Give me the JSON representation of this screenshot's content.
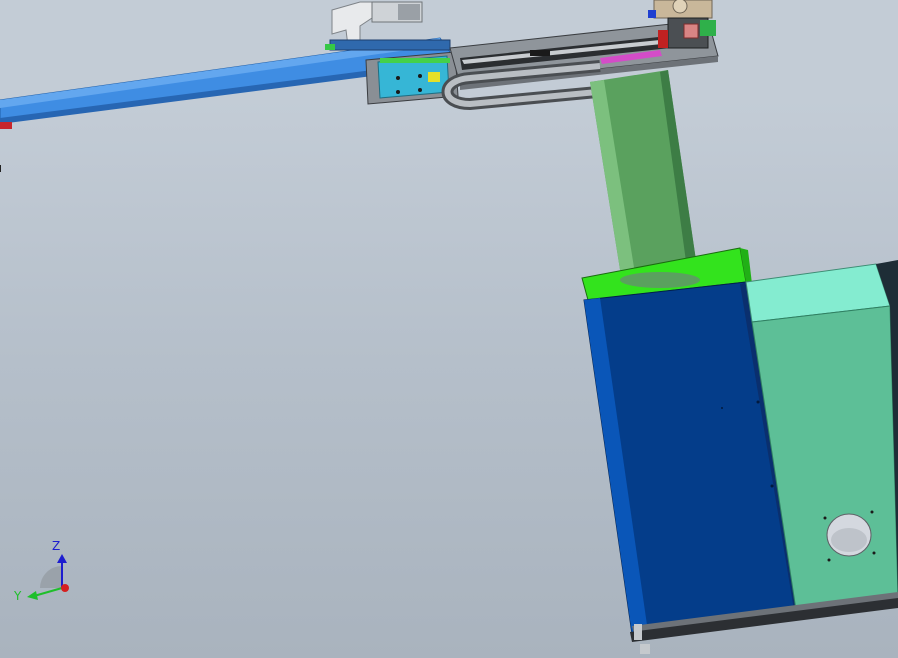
{
  "viewport": {
    "background_top": "#c3ccd6",
    "background_bottom": "#a9b3be"
  },
  "model": {
    "parts": [
      "horizontal-arm",
      "gripper",
      "linear-slide",
      "cable-chain",
      "vertical-column",
      "base-cabinet",
      "side-panel",
      "round-port"
    ],
    "colors": {
      "arm": "#3f8de3",
      "arm_dark": "#2766b3",
      "slide_body": "#8f959b",
      "slide_dark": "#3a3d41",
      "carriage": "#36b6d6",
      "column": "#5aa15e",
      "column_dark": "#3d7d45",
      "column_collar": "#33e31d",
      "cabinet_front": "#043d8a",
      "cabinet_edge": "#0a2f6e",
      "side_panel": "#5dbf97",
      "side_panel_top": "#84ecd0",
      "port": "#d4d8df"
    }
  },
  "triad": {
    "z_label": "Z",
    "y_label": "Y",
    "x_label": "",
    "z_color": "#1d1dcf",
    "y_color": "#1fbf2a",
    "x_color": "#d42020"
  }
}
